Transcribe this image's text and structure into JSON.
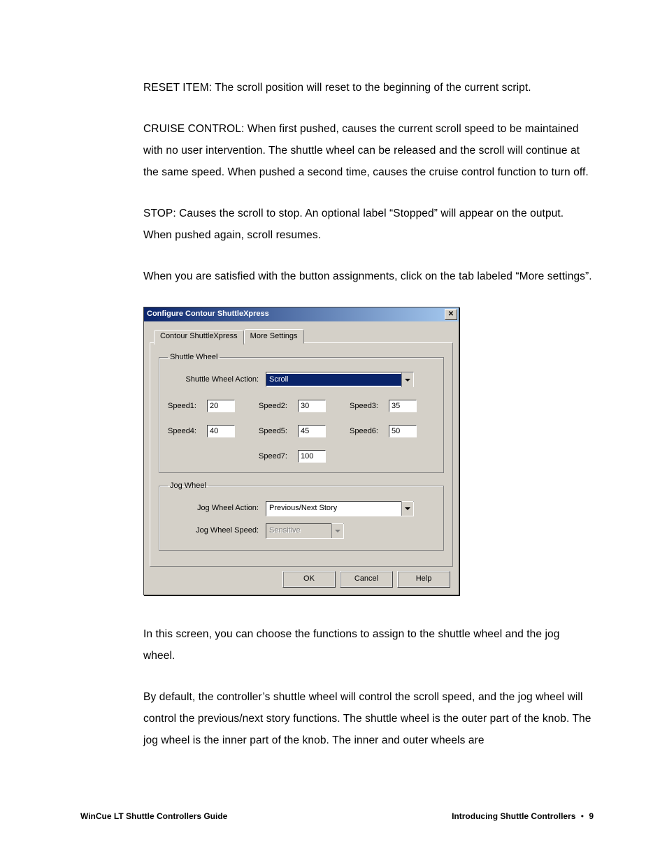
{
  "body": {
    "p1": "RESET ITEM: The scroll position will reset to the beginning of the current script.",
    "p2": "CRUISE CONTROL: When first pushed, causes the current scroll speed to be maintained with no user intervention. The shuttle wheel can be released and the scroll will continue at the same speed. When pushed a second time, causes the cruise control function to turn off.",
    "p3": "STOP: Causes the scroll to stop. An optional label “Stopped” will appear on the output. When pushed again, scroll resumes.",
    "p4": "When you are satisfied with the button assignments, click on the tab labeled “More settings”.",
    "p5": "In this screen, you can choose the functions to assign to the shuttle wheel and the jog wheel.",
    "p6": "By default, the controller’s shuttle wheel will control the scroll speed, and the jog wheel will control the previous/next story functions. The shuttle wheel is the outer part of the knob. The jog wheel is the inner part of the knob. The inner and outer wheels are"
  },
  "dialog": {
    "title": "Configure Contour ShuttleXpress",
    "tabs": {
      "tab1": "Contour ShuttleXpress",
      "tab2": "More Settings"
    },
    "shuttle": {
      "legend": "Shuttle Wheel",
      "action_label": "Shuttle Wheel  Action:",
      "action_value": "Scroll",
      "speeds": {
        "s1_label": "Speed1:",
        "s1_value": "20",
        "s2_label": "Speed2:",
        "s2_value": "30",
        "s3_label": "Speed3:",
        "s3_value": "35",
        "s4_label": "Speed4:",
        "s4_value": "40",
        "s5_label": "Speed5:",
        "s5_value": "45",
        "s6_label": "Speed6:",
        "s6_value": "50",
        "s7_label": "Speed7:",
        "s7_value": "100"
      }
    },
    "jog": {
      "legend": "Jog Wheel",
      "action_label": "Jog Wheel Action:",
      "action_value": "Previous/Next Story",
      "speed_label": "Jog Wheel Speed:",
      "speed_value": "Sensitive"
    },
    "buttons": {
      "ok": "OK",
      "cancel": "Cancel",
      "help": "Help"
    }
  },
  "footer": {
    "left": "WinCue LT Shuttle Controllers Guide",
    "right_section": "Introducing Shuttle Controllers",
    "bullet": "•",
    "page": "9"
  }
}
